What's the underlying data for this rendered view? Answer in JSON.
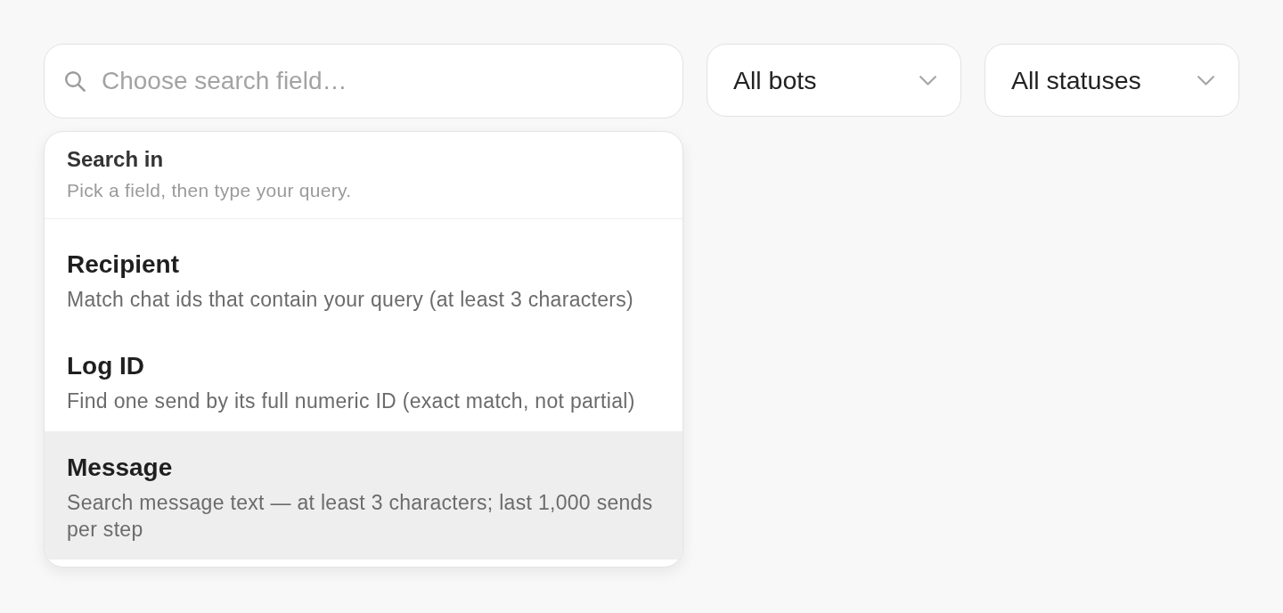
{
  "search": {
    "placeholder": "Choose search field…"
  },
  "filters": [
    {
      "value": "All bots"
    },
    {
      "value": "All statuses"
    }
  ],
  "search_menu": {
    "title": "Search in",
    "subtitle": "Pick a field, then type your query.",
    "options": [
      {
        "label": "Recipient",
        "description": "Match chat ids that contain your query (at least 3 characters)",
        "selected": false
      },
      {
        "label": "Log ID",
        "description": "Find one send by its full numeric ID (exact match, not partial)",
        "selected": false
      },
      {
        "label": "Message",
        "description": "Search message text — at least 3 characters; last 1,000 sends per step",
        "selected": true
      }
    ]
  }
}
